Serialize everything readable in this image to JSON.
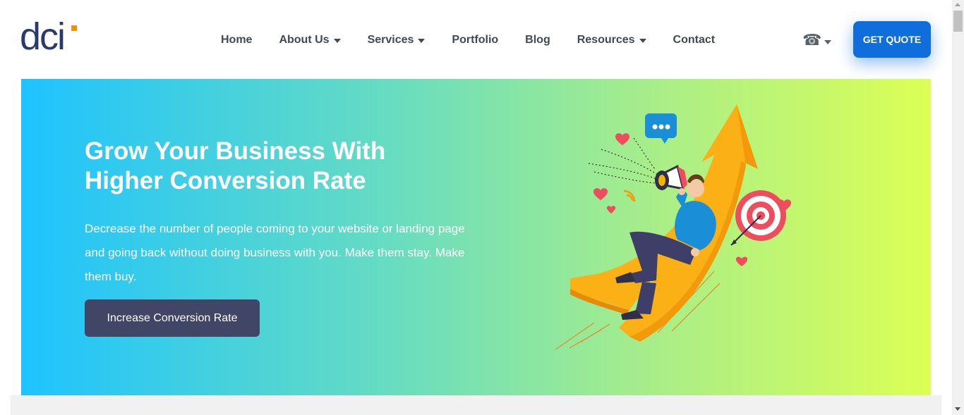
{
  "header": {
    "logo_text": "dci",
    "nav": [
      {
        "label": "Home",
        "dropdown": false
      },
      {
        "label": "About Us",
        "dropdown": true
      },
      {
        "label": "Services",
        "dropdown": true
      },
      {
        "label": "Portfolio",
        "dropdown": false
      },
      {
        "label": "Blog",
        "dropdown": false
      },
      {
        "label": "Resources",
        "dropdown": true
      },
      {
        "label": "Contact",
        "dropdown": false
      }
    ],
    "phone_icon": "phone-icon",
    "quote_button": "GET QUOTE"
  },
  "hero": {
    "title_line1": "Grow Your Business With",
    "title_line2": "Higher Conversion Rate",
    "description": "Decrease the number of people coming to your website or landing page and going back without doing business with you. Make them stay. Make them buy.",
    "cta_label": "Increase Conversion Rate",
    "illustration": "growth-arrow-megaphone-target-illustration"
  },
  "colors": {
    "brand_blue": "#0f6edc",
    "logo_navy": "#2a3b6b",
    "logo_accent": "#f39200",
    "cta_bg": "#414666",
    "gradient_start": "#1ec3ff",
    "gradient_end": "#dcff55"
  }
}
